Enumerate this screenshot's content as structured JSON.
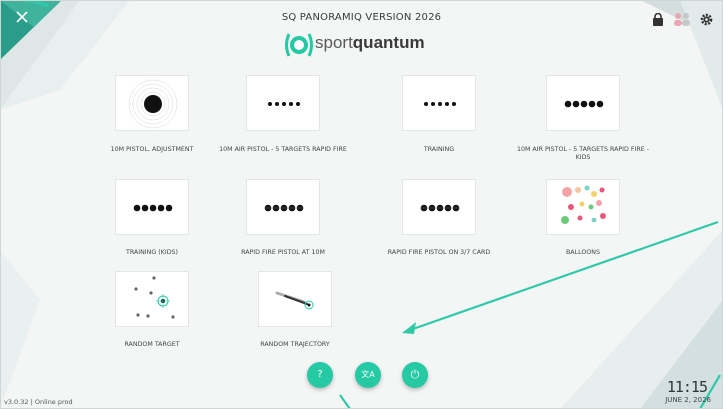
{
  "header": {
    "title": "SQ PANORAMIQ VERSION 2026",
    "logo_text_light": "sport",
    "logo_text_bold": "quantum"
  },
  "top_icons": [
    "lock-icon",
    "users-icon",
    "gear-icon"
  ],
  "tiles": [
    {
      "label": "10M PISTOL, ADJUSTMENT",
      "icon": "single-target"
    },
    {
      "label": "10M AIR PISTOL - 5 TARGETS RAPID FIRE",
      "icon": "five-small-dots"
    },
    {
      "label": "TRAINING",
      "icon": "five-small-dots"
    },
    {
      "label": "10M AIR PISTOL - 5 TARGETS RAPID FIRE - KIDS",
      "icon": "five-large-dots"
    },
    {
      "label": "TRAINING (KIDS)",
      "icon": "five-large-dots"
    },
    {
      "label": "RAPID FIRE PISTOL AT 10M",
      "icon": "five-ringed-dots"
    },
    {
      "label": "RAPID FIRE PISTOL ON 3/7 CARD",
      "icon": "five-ringed-dots"
    },
    {
      "label": "BALLOONS",
      "icon": "balloons"
    },
    {
      "label": "RANDOM TARGET",
      "icon": "random-target"
    },
    {
      "label": "RANDOM TRAJECTORY",
      "icon": "random-trajectory"
    }
  ],
  "bottom_buttons": {
    "help": "?",
    "language": "文A",
    "power": "⏻"
  },
  "footer": {
    "version": "v3.0.32 | Online prod",
    "time": "11:15",
    "date": "JUNE 2, 2026"
  },
  "colors": {
    "accent": "#25c9a3",
    "background": "#f4f6f6"
  }
}
